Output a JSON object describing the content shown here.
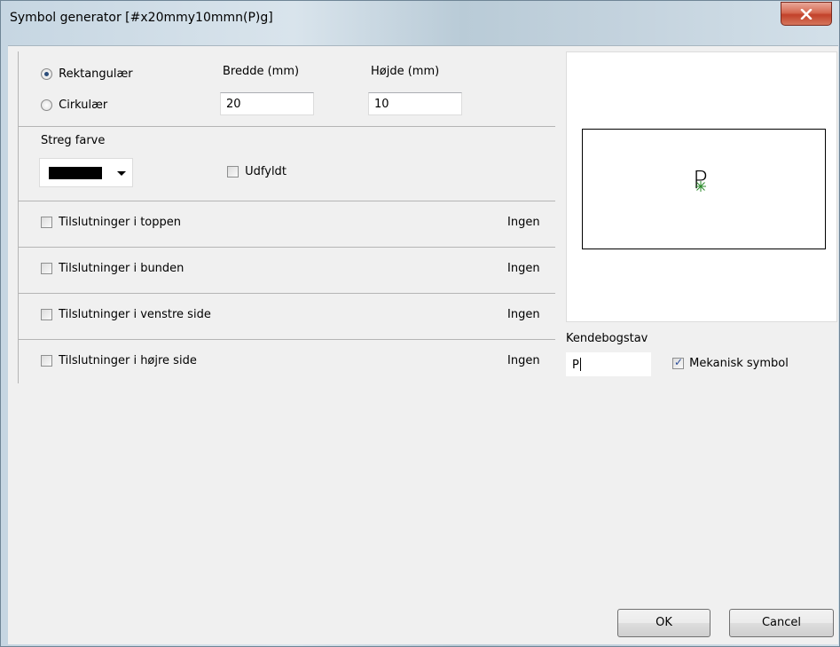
{
  "window": {
    "title": "Symbol generator [#x20mmy10mmn(P)g]",
    "close_icon": "x-icon"
  },
  "shape": {
    "options": [
      "Rektangulær",
      "Cirkulær"
    ],
    "selected": "Rektangulær",
    "width_label": "Bredde (mm)",
    "width_value": "20",
    "height_label": "Højde (mm)",
    "height_value": "10"
  },
  "stroke": {
    "label": "Streg farve",
    "color": "#000000",
    "fill_label": "Udfyldt",
    "fill_checked": false
  },
  "connections": [
    {
      "label": "Tilslutninger i toppen",
      "value": "Ingen"
    },
    {
      "label": "Tilslutninger i bunden",
      "value": "Ingen"
    },
    {
      "label": "Tilslutninger i venstre side",
      "value": "Ingen"
    },
    {
      "label": "Tilslutninger i højre side",
      "value": "Ingen"
    }
  ],
  "preview": {
    "letter": "P"
  },
  "identifier": {
    "label": "Kendebogstav",
    "value": "P",
    "mechanical_label": "Mekanisk symbol",
    "mechanical_checked": true
  },
  "buttons": {
    "ok": "OK",
    "cancel": "Cancel"
  }
}
